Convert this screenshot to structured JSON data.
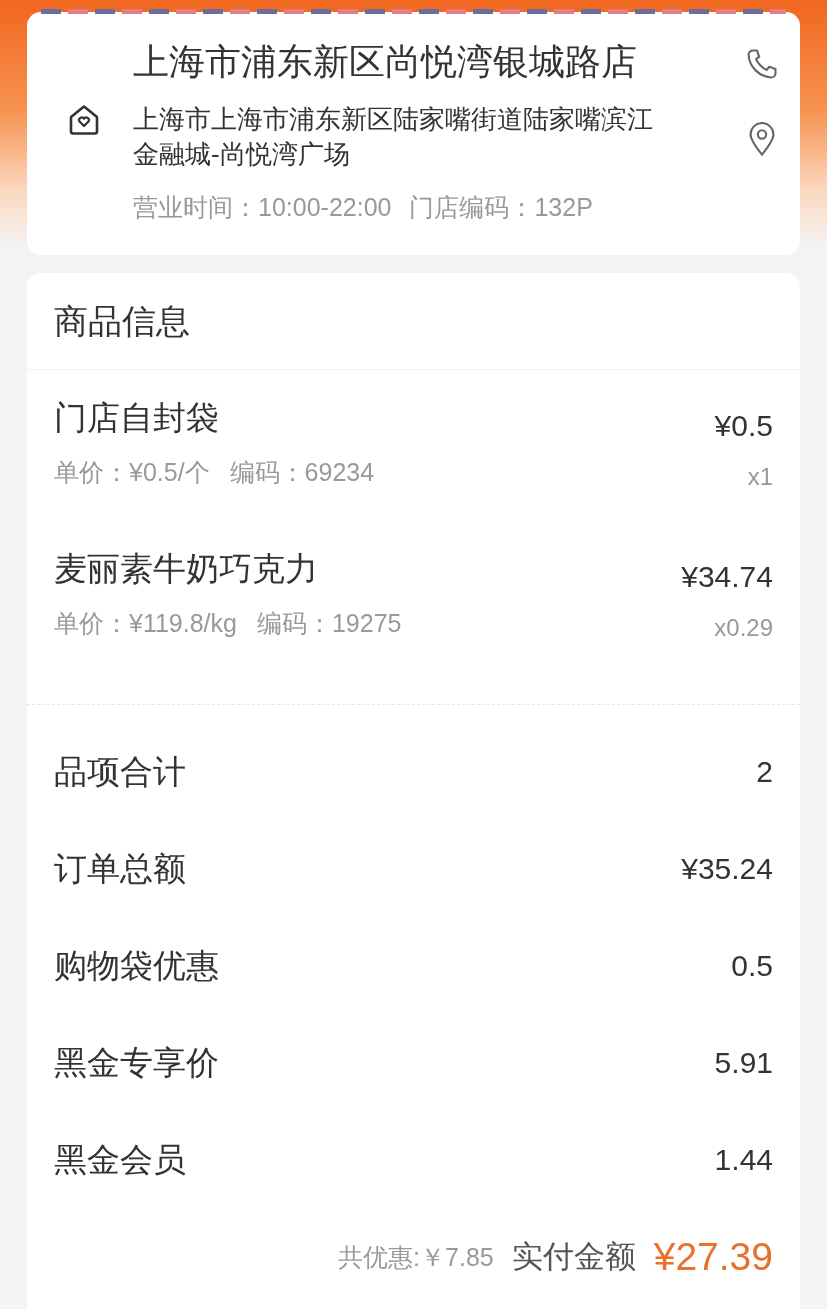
{
  "store": {
    "name": "上海市浦东新区尚悦湾银城路店",
    "address": "上海市上海市浦东新区陆家嘴街道陆家嘴滨江金融城-尚悦湾广场",
    "hours": "营业时间：10:00-22:00",
    "code": "门店编码：132P"
  },
  "products_section": {
    "title": "商品信息",
    "items": [
      {
        "name": "门店自封袋",
        "price": "¥0.5",
        "unit_price": "单价：¥0.5/个",
        "code": "编码：69234",
        "quantity": "x1"
      },
      {
        "name": "麦丽素牛奶巧克力",
        "price": "¥34.74",
        "unit_price": "单价：¥119.8/kg",
        "code": "编码：19275",
        "quantity": "x0.29"
      }
    ]
  },
  "summary": [
    {
      "label": "品项合计",
      "value": "2"
    },
    {
      "label": "订单总额",
      "value": "¥35.24"
    },
    {
      "label": "购物袋优惠",
      "value": "0.5"
    },
    {
      "label": "黑金专享价",
      "value": "5.91"
    },
    {
      "label": "黑金会员",
      "value": "1.44"
    }
  ],
  "footer": {
    "discount": "共优惠:￥7.85",
    "total_label": "实付金额",
    "total": "¥27.39"
  }
}
